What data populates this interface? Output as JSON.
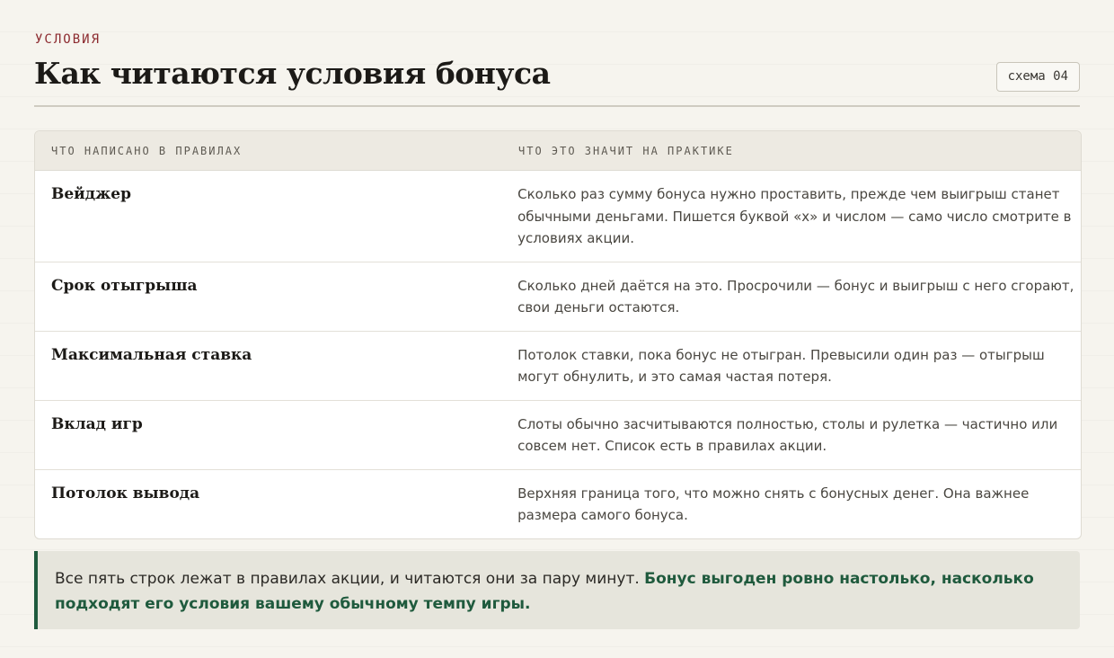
{
  "header": {
    "eyebrow": "УСЛОВИЯ",
    "title": "Как читаются условия бонуса",
    "badge": "схема 04"
  },
  "table": {
    "columns": [
      "ЧТО НАПИСАНО В ПРАВИЛАХ",
      "ЧТО ЭТО ЗНАЧИТ НА ПРАКТИКЕ"
    ],
    "rows": [
      {
        "term": "Вейджер",
        "desc": "Сколько раз сумму бонуса нужно проставить, прежде чем выигрыш станет обычными деньгами. Пишется буквой «x» и числом — само число смотрите в условиях акции."
      },
      {
        "term": "Срок отыгрыша",
        "desc": "Сколько дней даётся на это. Просрочили — бонус и выигрыш с него сгорают, свои деньги остаются."
      },
      {
        "term": "Максимальная ставка",
        "desc": "Потолок ставки, пока бонус не отыгран. Превысили один раз — отыгрыш могут обнулить, и это самая частая потеря."
      },
      {
        "term": "Вклад игр",
        "desc": "Слоты обычно засчитываются полностью, столы и рулетка — частично или совсем нет. Список есть в правилах акции."
      },
      {
        "term": "Потолок вывода",
        "desc": "Верхняя граница того, что можно снять с бонусных денег. Она важнее размера самого бонуса."
      }
    ]
  },
  "note": {
    "text": "Все пять строк лежат в правилах акции, и читаются они за пару минут.",
    "accent": "Бонус выгоден ровно настолько, насколько подходят его условия вашему обычному темпу игры."
  },
  "colors": {
    "accent_red": "#8c2a2f",
    "accent_green": "#1f5a3d",
    "background": "#f6f4ee"
  }
}
